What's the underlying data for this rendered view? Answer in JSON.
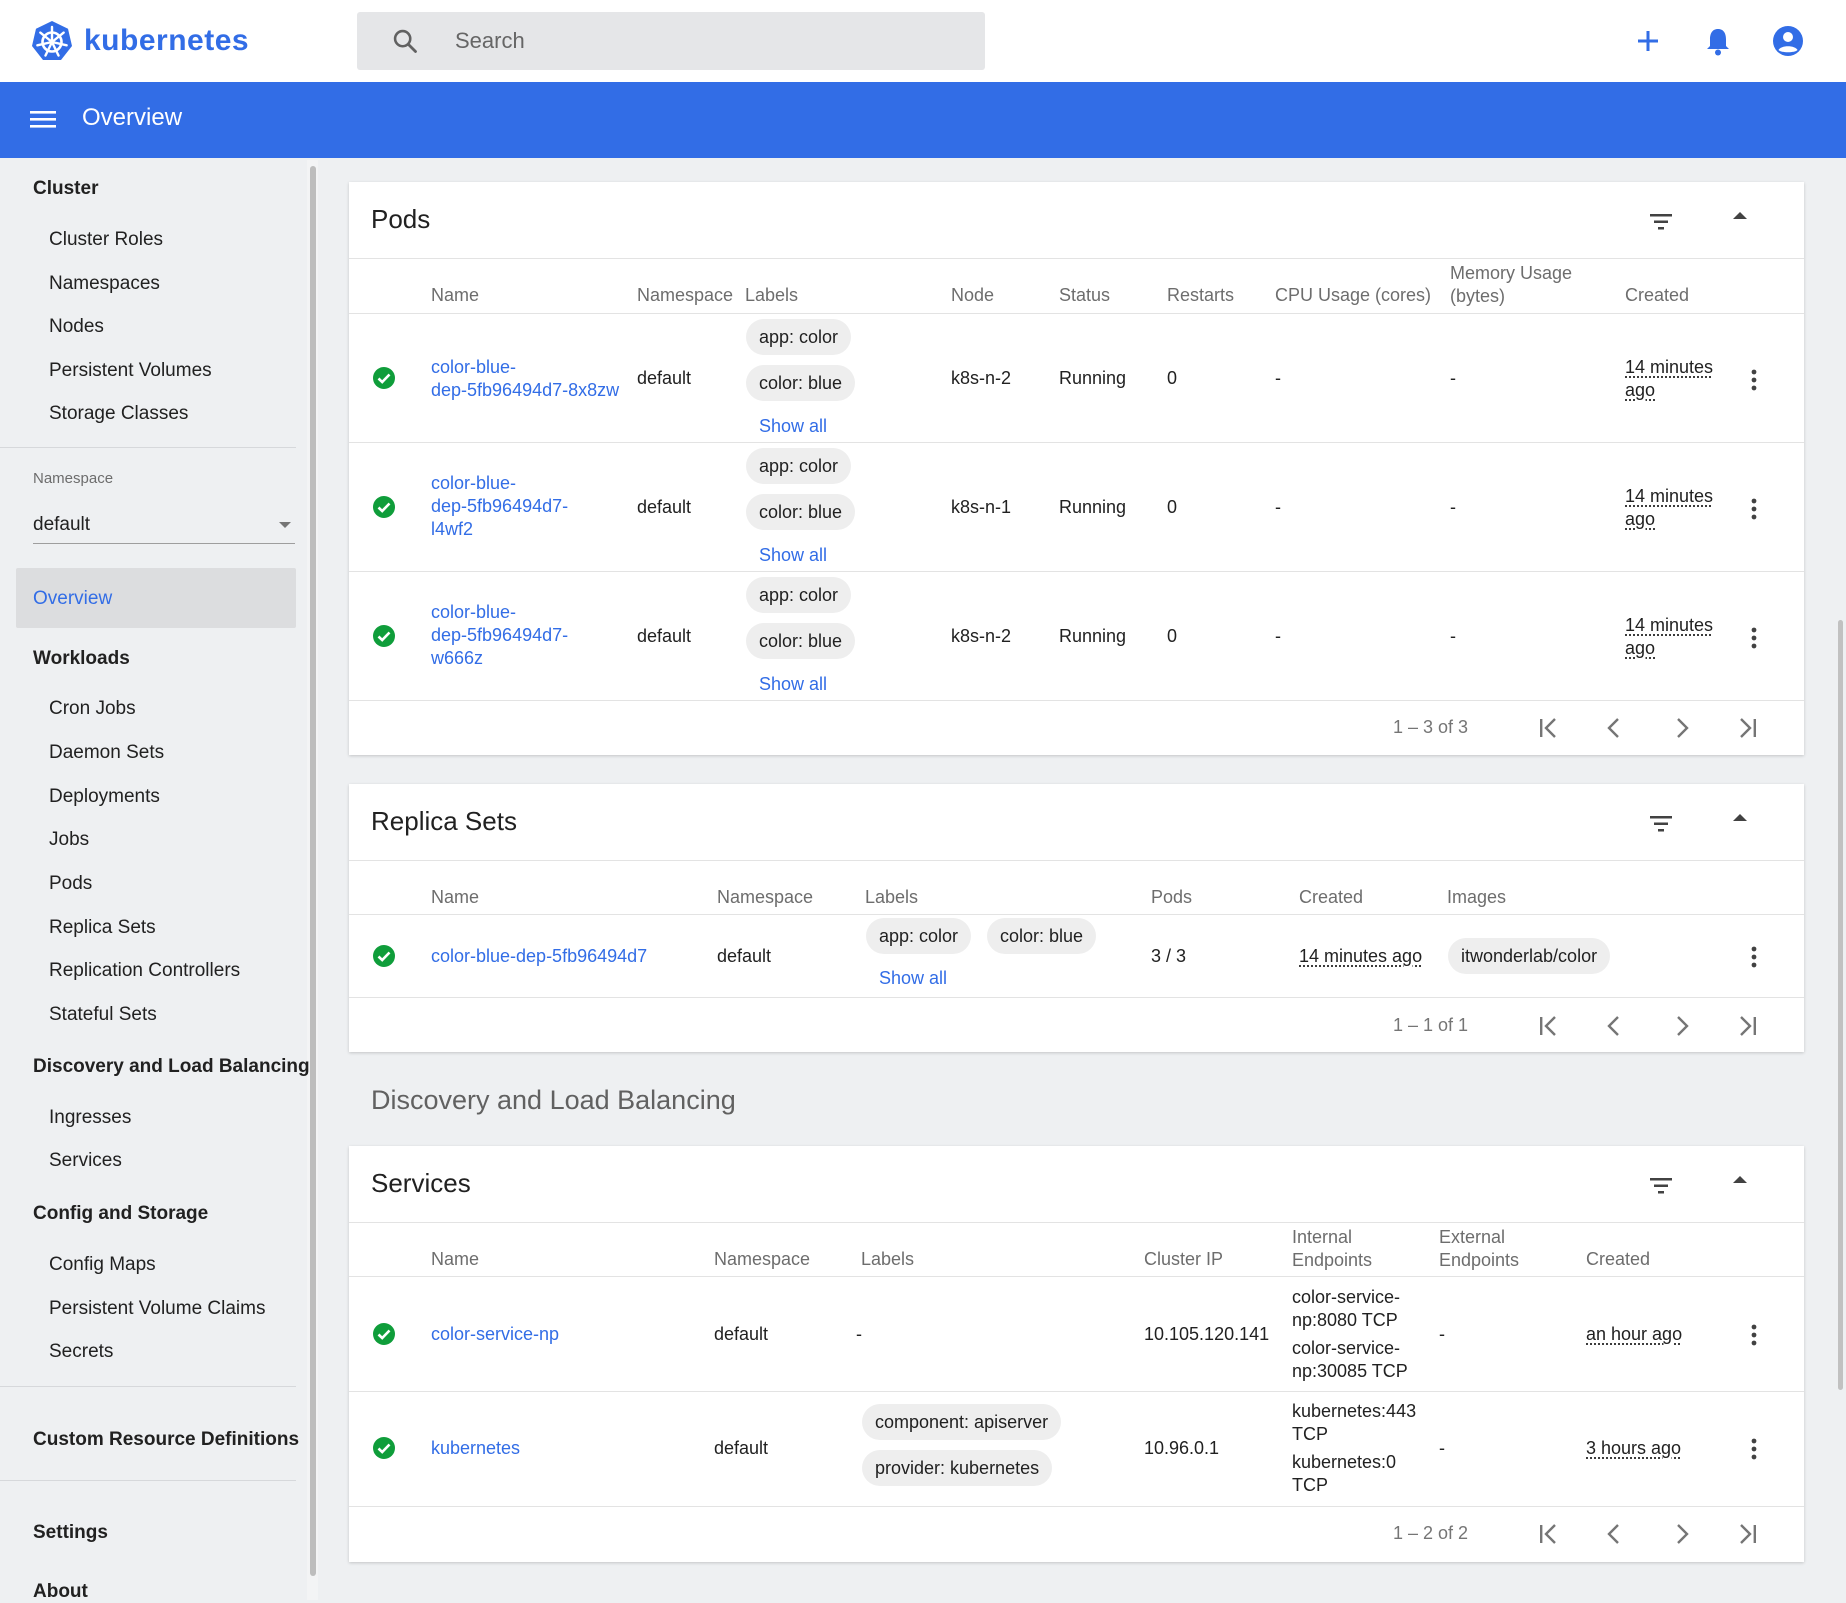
{
  "brand": {
    "name": "kubernetes"
  },
  "search": {
    "placeholder": "Search"
  },
  "appbar": {
    "title": "Overview"
  },
  "sidebar": {
    "cluster_head": "Cluster",
    "cluster_items": [
      "Cluster Roles",
      "Namespaces",
      "Nodes",
      "Persistent Volumes",
      "Storage Classes"
    ],
    "namespace_label": "Namespace",
    "namespace_value": "default",
    "overview": "Overview",
    "workloads_head": "Workloads",
    "workloads_items": [
      "Cron Jobs",
      "Daemon Sets",
      "Deployments",
      "Jobs",
      "Pods",
      "Replica Sets",
      "Replication Controllers",
      "Stateful Sets"
    ],
    "discovery_head": "Discovery and Load Balancing",
    "discovery_items": [
      "Ingresses",
      "Services"
    ],
    "config_head": "Config and Storage",
    "config_items": [
      "Config Maps",
      "Persistent Volume Claims",
      "Secrets"
    ],
    "crd": "Custom Resource Definitions",
    "settings": "Settings",
    "about": "About"
  },
  "pods": {
    "title": "Pods",
    "headers": {
      "name": "Name",
      "namespace": "Namespace",
      "labels": "Labels",
      "node": "Node",
      "status": "Status",
      "restarts": "Restarts",
      "cpu": "CPU Usage (cores)",
      "memory_1": "Memory Usage",
      "memory_2": "(bytes)",
      "created": "Created"
    },
    "rows": [
      {
        "name_1": "color-blue-",
        "name_2": "dep-5fb96494d7-8x8zw",
        "name_3": "",
        "namespace": "default",
        "label_1": "app: color",
        "label_2": "color: blue",
        "show_all": "Show all",
        "node": "k8s-n-2",
        "status": "Running",
        "restarts": "0",
        "cpu": "-",
        "memory": "-",
        "created_1": "14 minutes",
        "created_2": "ago"
      },
      {
        "name_1": "color-blue-",
        "name_2": "dep-5fb96494d7-",
        "name_3": "l4wf2",
        "namespace": "default",
        "label_1": "app: color",
        "label_2": "color: blue",
        "show_all": "Show all",
        "node": "k8s-n-1",
        "status": "Running",
        "restarts": "0",
        "cpu": "-",
        "memory": "-",
        "created_1": "14 minutes",
        "created_2": "ago"
      },
      {
        "name_1": "color-blue-",
        "name_2": "dep-5fb96494d7-",
        "name_3": "w666z",
        "namespace": "default",
        "label_1": "app: color",
        "label_2": "color: blue",
        "show_all": "Show all",
        "node": "k8s-n-2",
        "status": "Running",
        "restarts": "0",
        "cpu": "-",
        "memory": "-",
        "created_1": "14 minutes",
        "created_2": "ago"
      }
    ],
    "pager": "1 – 3 of 3"
  },
  "replica_sets": {
    "title": "Replica Sets",
    "headers": {
      "name": "Name",
      "namespace": "Namespace",
      "labels": "Labels",
      "pods": "Pods",
      "created": "Created",
      "images": "Images"
    },
    "rows": [
      {
        "name": "color-blue-dep-5fb96494d7",
        "namespace": "default",
        "label_1": "app: color",
        "label_2": "color: blue",
        "show_all": "Show all",
        "pods": "3 / 3",
        "created": "14 minutes ago",
        "image": "itwonderlab/color"
      }
    ],
    "pager": "1 – 1 of 1"
  },
  "discovery_section": "Discovery and Load Balancing",
  "services": {
    "title": "Services",
    "headers": {
      "name": "Name",
      "namespace": "Namespace",
      "labels": "Labels",
      "cluster_ip": "Cluster IP",
      "internal_1": "Internal",
      "internal_2": "Endpoints",
      "external_1": "External",
      "external_2": "Endpoints",
      "created": "Created"
    },
    "rows": [
      {
        "name": "color-service-np",
        "namespace": "default",
        "labels": "-",
        "cluster_ip": "10.105.120.141",
        "ep_1": "color-service-",
        "ep_2": "np:8080 TCP",
        "ep_3": "color-service-",
        "ep_4": "np:30085 TCP",
        "external": "-",
        "created": "an hour ago"
      },
      {
        "name": "kubernetes",
        "namespace": "default",
        "label_1": "component: apiserver",
        "label_2": "provider: kubernetes",
        "cluster_ip": "10.96.0.1",
        "ep_1": "kubernetes:443",
        "ep_2": "TCP",
        "ep_3": "kubernetes:0",
        "ep_4": "TCP",
        "external": "-",
        "created": "3 hours ago"
      }
    ],
    "pager": "1 – 2 of 2"
  },
  "colors": {
    "brand_blue": "#326de6",
    "ready_green": "#0f9d3a"
  },
  "icons": [
    "kubernetes-logo-icon",
    "search-icon",
    "plus-icon",
    "bell-icon",
    "account-icon",
    "menu-icon",
    "filter-icon",
    "chevron-up-icon",
    "check-circle-icon",
    "kebab-icon",
    "first-page-icon",
    "prev-page-icon",
    "next-page-icon",
    "last-page-icon"
  ]
}
